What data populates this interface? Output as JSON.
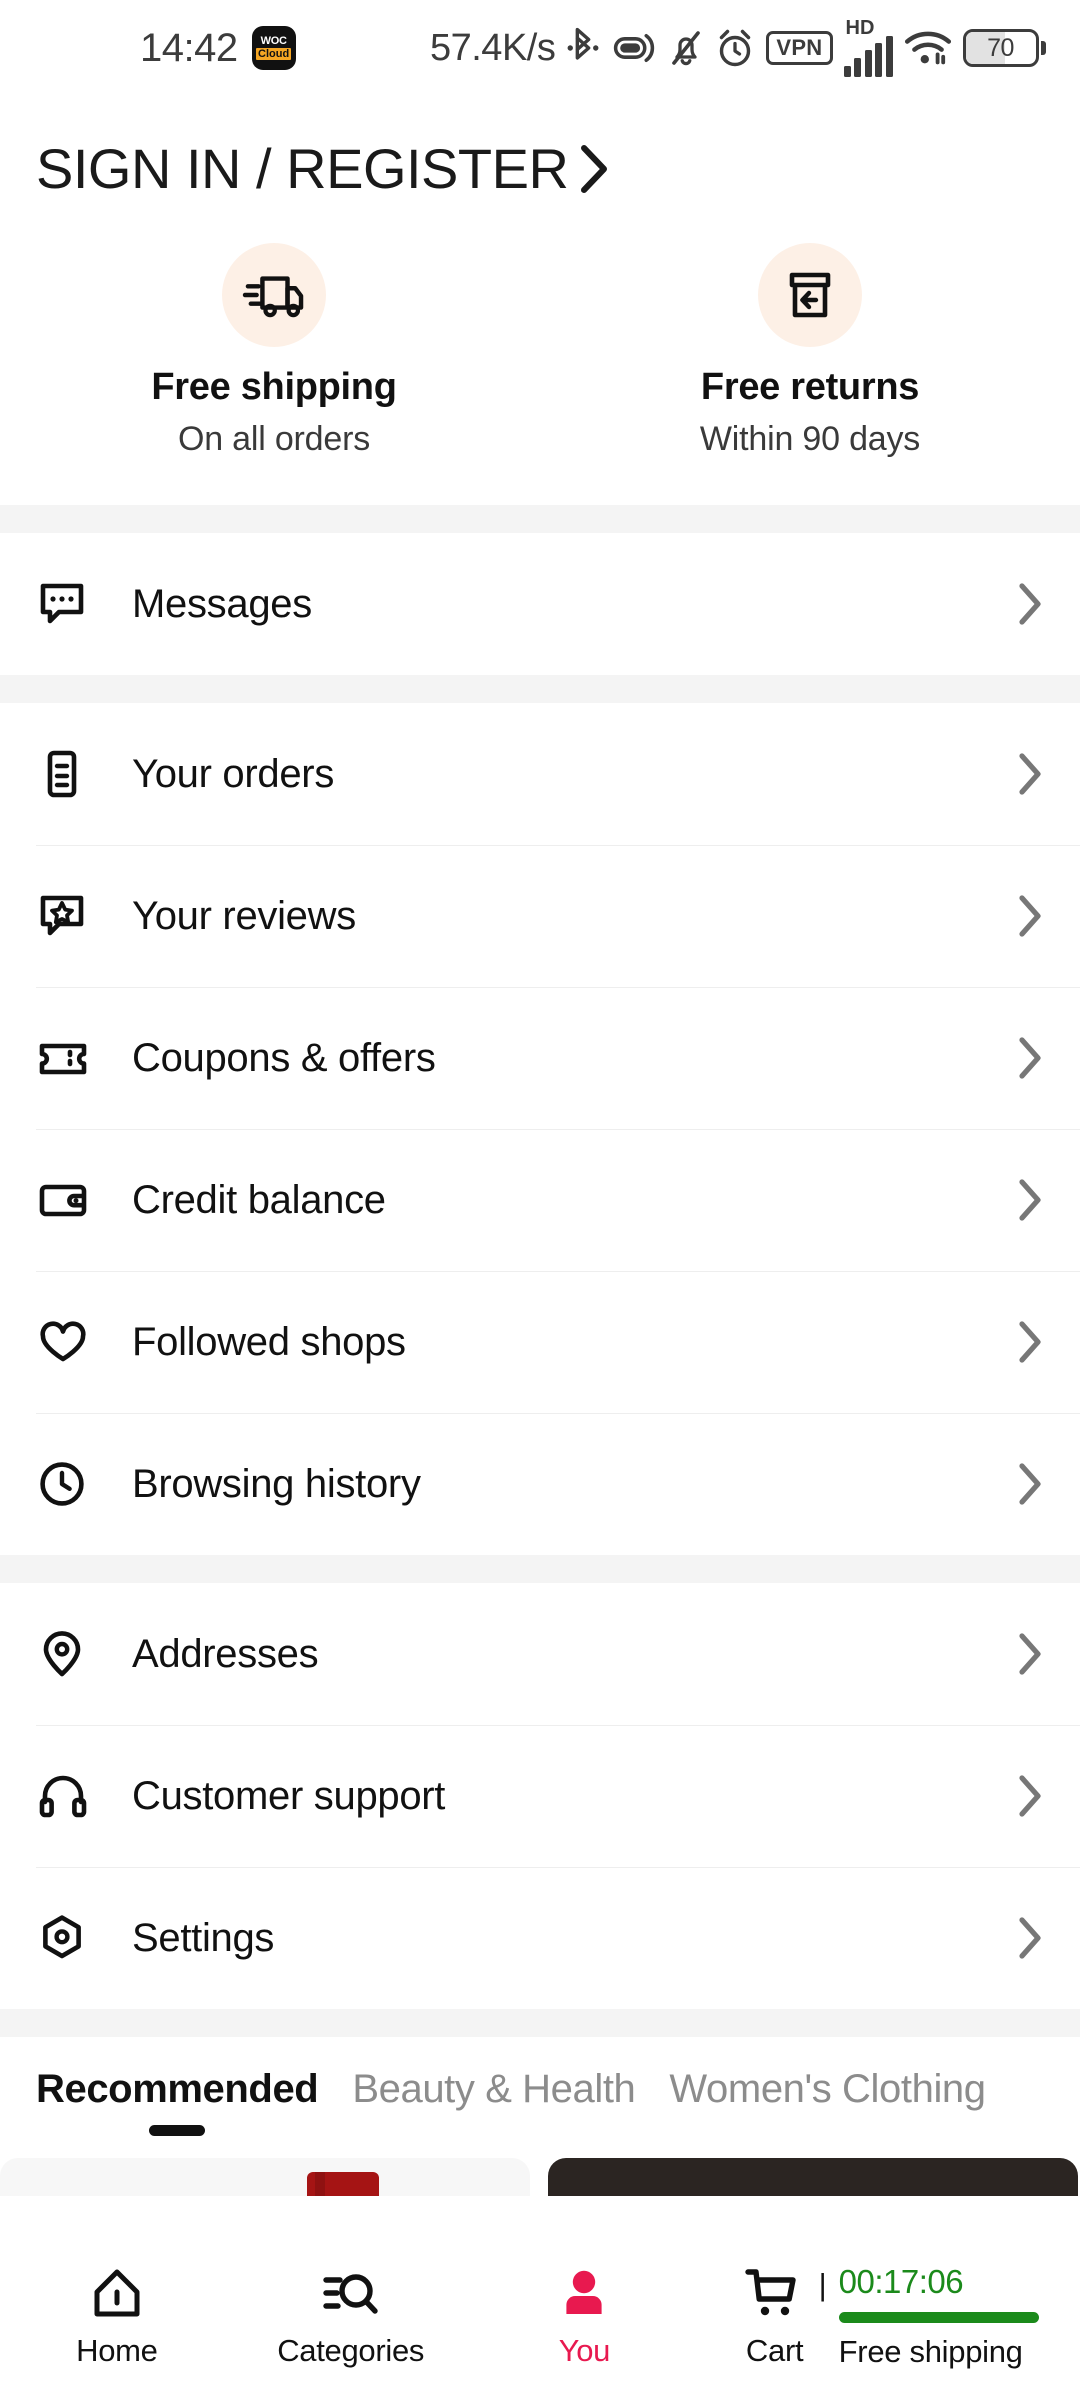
{
  "status_bar": {
    "time": "14:42",
    "app_badge_line1": "WOC",
    "app_badge_line2": "Cloud",
    "network_speed": "57.4K/s",
    "vpn_label": "VPN",
    "hd_label": "HD",
    "battery_level": "70",
    "icons": [
      "bluetooth-icon",
      "earbuds-icon",
      "mute-bell-icon",
      "alarm-clock-icon",
      "vpn-icon",
      "signal-bars-icon",
      "wifi-icon",
      "battery-icon"
    ]
  },
  "header": {
    "sign_in_label": "SIGN IN / REGISTER"
  },
  "benefits": [
    {
      "icon": "delivery-truck-icon",
      "title": "Free shipping",
      "subtitle": "On all orders"
    },
    {
      "icon": "return-box-icon",
      "title": "Free returns",
      "subtitle": "Within 90 days"
    }
  ],
  "menu_groups": [
    {
      "items": [
        {
          "icon": "message-bubble-icon",
          "label": "Messages"
        }
      ]
    },
    {
      "items": [
        {
          "icon": "order-receipt-icon",
          "label": "Your orders"
        },
        {
          "icon": "review-star-bubble-icon",
          "label": "Your reviews"
        },
        {
          "icon": "coupon-ticket-icon",
          "label": "Coupons & offers"
        },
        {
          "icon": "wallet-icon",
          "label": "Credit balance"
        },
        {
          "icon": "heart-icon",
          "label": "Followed shops"
        },
        {
          "icon": "clock-history-icon",
          "label": "Browsing history"
        }
      ]
    },
    {
      "items": [
        {
          "icon": "location-pin-icon",
          "label": "Addresses"
        },
        {
          "icon": "headset-icon",
          "label": "Customer support"
        },
        {
          "icon": "hexagon-gear-icon",
          "label": "Settings"
        }
      ]
    }
  ],
  "tabs": [
    {
      "label": "Recommended",
      "active": true
    },
    {
      "label": "Beauty & Health",
      "active": false
    },
    {
      "label": "Women's Clothing",
      "active": false
    }
  ],
  "bottom_nav": {
    "items": [
      {
        "icon": "home-icon",
        "label": "Home",
        "active": false
      },
      {
        "icon": "categories-search-icon",
        "label": "Categories",
        "active": false
      },
      {
        "icon": "person-icon",
        "label": "You",
        "active": true
      }
    ],
    "cart": {
      "icon": "shopping-cart-icon",
      "label": "Cart",
      "divider": "|",
      "timer": "00:17:06",
      "shipping_label": "Free shipping"
    }
  },
  "colors": {
    "accent_pink": "#E8194F",
    "timer_green": "#1B8A1B",
    "benefit_circle": "#FDF0E6",
    "section_gap": "#F4F4F4",
    "chevron_gray": "#777777"
  }
}
